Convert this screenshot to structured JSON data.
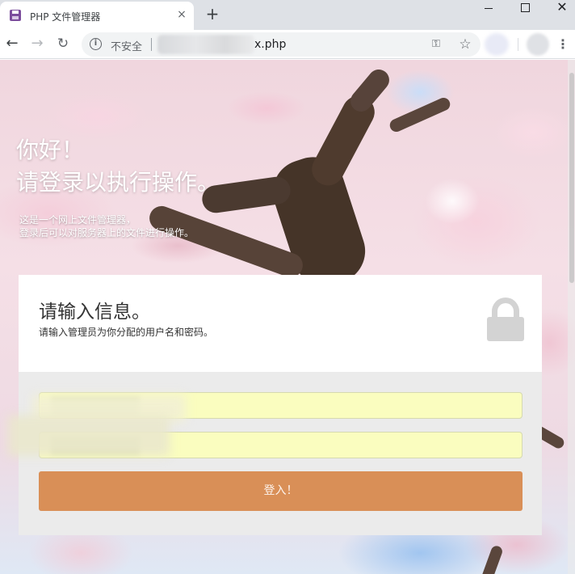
{
  "browser": {
    "tab_title": "PHP 文件管理器",
    "tab_close_icon": "×",
    "new_tab_icon": "+",
    "window_close_icon": "✕",
    "security_label": "不安全",
    "info_icon": "i",
    "url_visible": "x.php",
    "key_icon": "⚿",
    "star_icon": "☆",
    "menu_icon": "⋮",
    "back_icon": "←",
    "forward_icon": "→",
    "reload_icon": "↻"
  },
  "hero": {
    "title_line1": "你好！",
    "title_line2": "请登录以执行操作。",
    "desc_line1": "这是一个网上文件管理器，",
    "desc_line2": "登录后可以对服务器上的文件进行操作。"
  },
  "login": {
    "title": "请输入信息。",
    "subtitle": "请输入管理员为你分配的用户名和密码。",
    "username_value": "",
    "password_value": "",
    "submit_label": "登入！"
  },
  "colors": {
    "button": "#d98f57",
    "autofill": "#fafdbf",
    "form_bg": "#ebebeb",
    "lock": "#d3d3d3"
  }
}
